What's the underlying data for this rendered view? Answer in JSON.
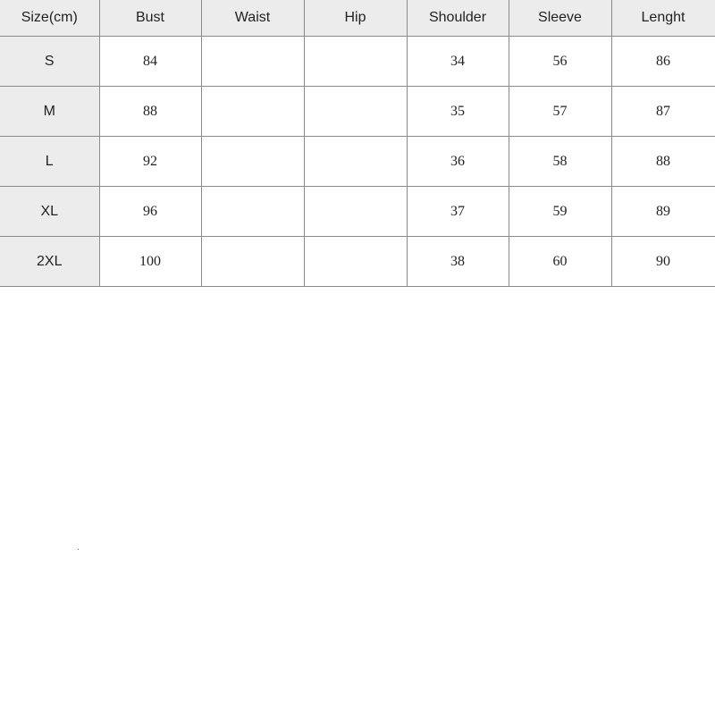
{
  "table": {
    "headers": [
      "Size(cm)",
      "Bust",
      "Waist",
      "Hip",
      "Shoulder",
      "Sleeve",
      "Lenght"
    ],
    "rows": [
      [
        "S",
        "84",
        "",
        "",
        "34",
        "56",
        "86"
      ],
      [
        "M",
        "88",
        "",
        "",
        "35",
        "57",
        "87"
      ],
      [
        "L",
        "92",
        "",
        "",
        "36",
        "58",
        "88"
      ],
      [
        "XL",
        "96",
        "",
        "",
        "37",
        "59",
        "89"
      ],
      [
        "2XL",
        "100",
        "",
        "",
        "38",
        "60",
        "90"
      ]
    ]
  }
}
